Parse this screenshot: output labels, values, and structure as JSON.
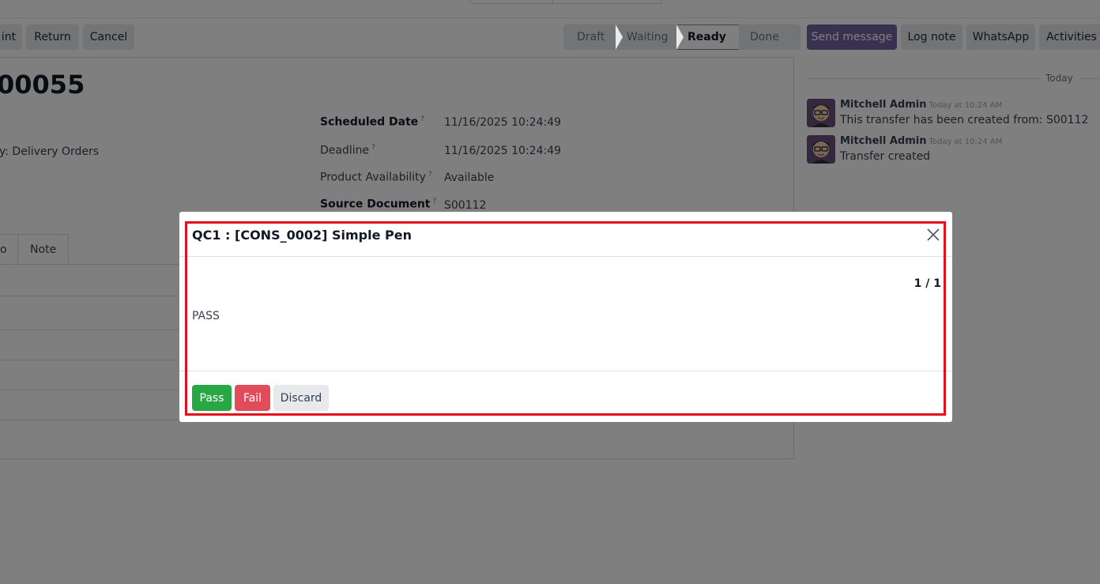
{
  "control_panel": {
    "print_label": "int",
    "return_label": "Return",
    "cancel_label": "Cancel"
  },
  "statusbar": {
    "stages": [
      "Draft",
      "Waiting",
      "Ready",
      "Done"
    ],
    "active": "Ready"
  },
  "record": {
    "name": "00055",
    "operation_type": "y: Delivery Orders",
    "fields": {
      "scheduled_date_label": "Scheduled Date",
      "scheduled_date_value": "11/16/2025 10:24:49",
      "deadline_label": "Deadline",
      "deadline_value": "11/16/2025 10:24:49",
      "availability_label": "Product Availability",
      "availability_value": "Available",
      "source_label": "Source Document",
      "source_value": "S00112",
      "help_mark": "?"
    },
    "tabs": [
      "o",
      "Note"
    ]
  },
  "chatter": {
    "send_message": "Send message",
    "log_note": "Log note",
    "whatsapp": "WhatsApp",
    "activities": "Activities",
    "today": "Today",
    "messages": [
      {
        "author": "Mitchell Admin",
        "time": "Today at 10:24 AM",
        "body": "This transfer has been created from: S00112"
      },
      {
        "author": "Mitchell Admin",
        "time": "Today at 10:24 AM",
        "body": "Transfer created"
      }
    ]
  },
  "dialog": {
    "title": "QC1 : [CONS_0002] Simple Pen",
    "counter": "1 / 1",
    "result": "PASS",
    "pass_label": "Pass",
    "fail_label": "Fail",
    "discard_label": "Discard"
  },
  "colors": {
    "pass": "#28a745",
    "fail": "#e04c5a",
    "send_message_bg": "#71639e",
    "highlight": "#e0111c"
  }
}
